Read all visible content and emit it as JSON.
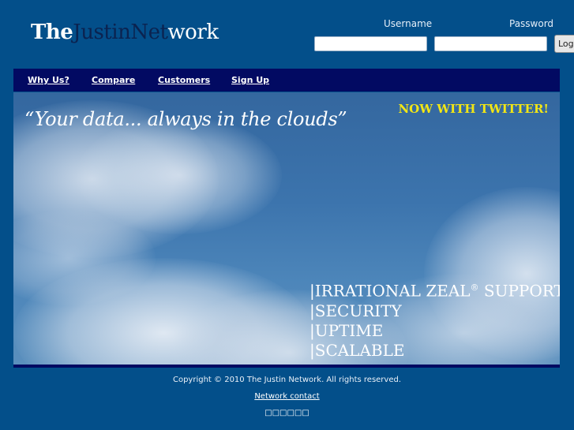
{
  "header": {
    "logo": {
      "part1": "The",
      "part2": "Justin",
      "part3": "Net",
      "part4": "work"
    },
    "login": {
      "username_label": "Username",
      "password_label": "Password",
      "username_value": "",
      "password_value": "",
      "button_label": "Log"
    }
  },
  "nav": {
    "items": [
      {
        "label": "Why Us?"
      },
      {
        "label": "Compare"
      },
      {
        "label": "Customers"
      },
      {
        "label": "Sign Up"
      }
    ]
  },
  "hero": {
    "tagline": "“Your data... always in the clouds”",
    "twitter": "NOW WITH TWITTER!",
    "features": [
      {
        "text": "|IRRATIONAL ZEAL",
        "sup": "®",
        "rest": " SUPPORT"
      },
      {
        "text": "|SECURITY"
      },
      {
        "text": "|UPTIME"
      },
      {
        "text": "|SCALABLE"
      }
    ]
  },
  "footer": {
    "copyright": "Copyright © 2010 The Justin Network. All rights reserved.",
    "contact": "Network contact",
    "extra": "□□□□□□"
  },
  "colors": {
    "background": "#034f8a",
    "nav": "#020a62",
    "accent_yellow": "#f2e615",
    "logo_dark": "#0b2350"
  }
}
